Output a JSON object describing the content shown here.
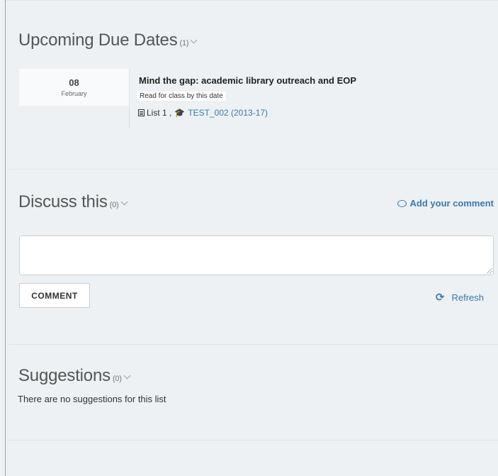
{
  "upcoming": {
    "title": "Upcoming Due Dates",
    "count": "(1)",
    "item": {
      "day": "08",
      "month": "February",
      "title": "Mind the gap: academic library outreach and EOP",
      "note": "Read for class by this date",
      "list_label": "List 1 ,",
      "course_label": "TEST_002 (2013-17)"
    }
  },
  "discuss": {
    "title": "Discuss this",
    "count": "(0)",
    "add_comment_label": "Add your comment",
    "comment_value": "",
    "comment_button_label": "COMMENT",
    "refresh_label": "Refresh"
  },
  "suggestions": {
    "title": "Suggestions",
    "count": "(0)",
    "empty_text": "There are no suggestions for this list"
  },
  "colors": {
    "background": "#edf1f3",
    "link": "#3a79b0"
  },
  "icons": [
    "list-icon",
    "graduation-cap-icon",
    "comment-bubble-icon",
    "refresh-icon",
    "chevron-down-icon"
  ]
}
